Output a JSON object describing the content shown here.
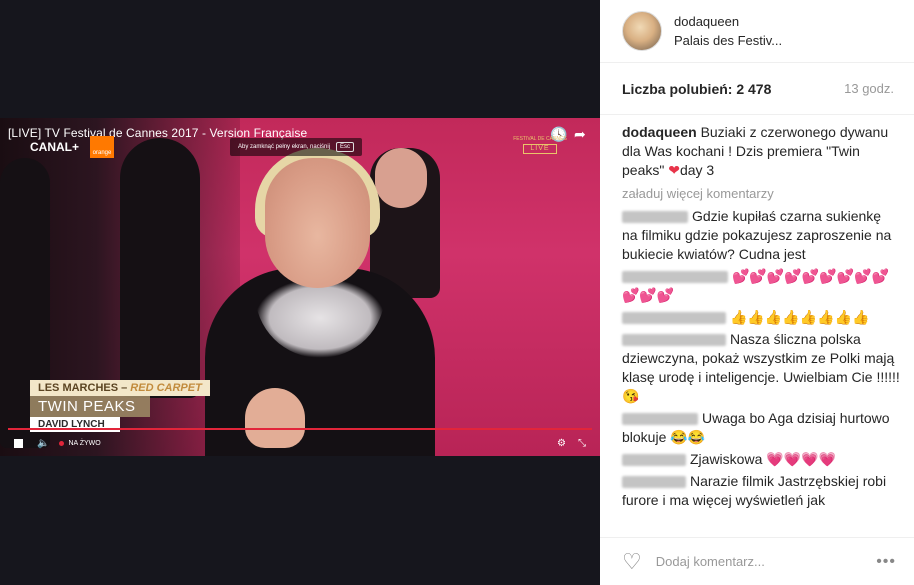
{
  "video": {
    "title": "[LIVE] TV Festival de Cannes 2017 - Version Française",
    "channel": "CANAL+",
    "sponsor": "orange",
    "exit_hint": "Aby zamknąć pełny ekran, naciśnij",
    "exit_key": "Esc",
    "festival_logo": "FESTIVAL DE CANNES",
    "festival_live": "LIVE",
    "lower_third": {
      "line1_a": "LES MARCHES – ",
      "line1_b": "RED CARPET",
      "line2": "TWIN PEAKS",
      "line3": "DAVID LYNCH"
    },
    "live_label": "NA ŻYWO",
    "icons": [
      "clock-icon",
      "share-icon",
      "stop-icon",
      "speaker-icon",
      "settings-icon",
      "fullscreen-exit-icon"
    ]
  },
  "post": {
    "username": "dodaqueen",
    "location": "Palais des Festiv...",
    "likes": "Liczba polubień: 2 478",
    "time": "13 godz.",
    "caption_user": "dodaqueen",
    "caption_text": "Buziaki z czerwonego dywanu dla Was kochani ! Dzis premiera \"Twin peaks\"",
    "caption_heart": "❤",
    "caption_tail": "day 3",
    "load_more": "załaduj więcej komentarzy",
    "comments": [
      {
        "text": "Gdzie kupiłaś czarna sukienkę na filmiku gdzie pokazujesz zaproszenie na bukiecie kwiatów? Cudna jest"
      },
      {
        "text": "💕💕💕💕💕💕💕💕💕💕💕💕"
      },
      {
        "text": "👍👍👍👍👍👍👍👍"
      },
      {
        "text": "Nasza śliczna polska dziewczyna, pokaż wszystkim ze Polki mają klasę urodę i inteligencje. Uwielbiam Cie !!!!!!😘"
      },
      {
        "text": "Uwaga bo Aga dzisiaj hurtowo blokuje 😂😂"
      },
      {
        "text": "Zjawiskowa 💗💗💗💗"
      },
      {
        "text": "Narazie filmik Jastrzębskiej robi furore i ma więcej wyświetleń jak"
      }
    ],
    "add_comment_placeholder": "Dodaj komentarz...",
    "more_label": "•••"
  }
}
